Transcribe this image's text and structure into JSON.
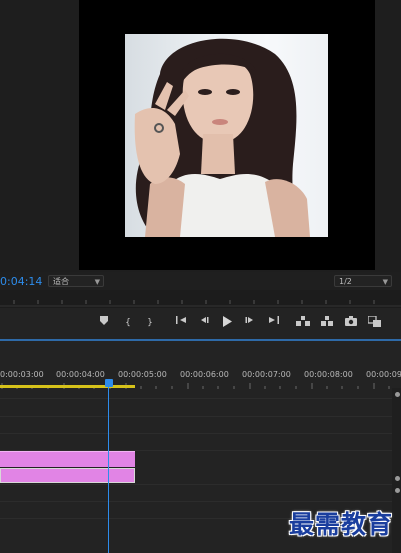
{
  "program_monitor": {
    "timecode": "0:04:14",
    "zoom_dropdown": "适合",
    "resolution_dropdown": "1/2"
  },
  "transport": {
    "buttons": [
      "add-marker",
      "mark-in",
      "mark-out",
      "go-to-in",
      "step-back",
      "play",
      "step-forward",
      "go-to-out",
      "lift",
      "extract",
      "export-frame",
      "comparison-view"
    ]
  },
  "timeline": {
    "ruler_labels": [
      "0:00:03:00",
      "00:00:04:00",
      "00:00:05:00",
      "00:00:06:00",
      "00:00:07:00",
      "00:00:08:00",
      "00:00:09:"
    ]
  },
  "watermark": "最需教育",
  "colors": {
    "accent": "#2d8ceb",
    "clip": "#e184e5",
    "work_area": "#d6c21a",
    "panel_bg": "#232323"
  }
}
